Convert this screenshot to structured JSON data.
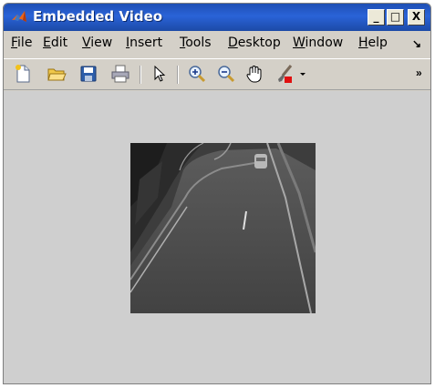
{
  "window": {
    "title": "Embedded Video"
  },
  "window_controls": {
    "minimize": "_",
    "maximize": "□",
    "close": "X"
  },
  "menu": {
    "items": [
      {
        "label": "File",
        "mnemonic": "F",
        "rest": "ile"
      },
      {
        "label": "Edit",
        "mnemonic": "E",
        "rest": "dit"
      },
      {
        "label": "View",
        "mnemonic": "V",
        "rest": "iew"
      },
      {
        "label": "Insert",
        "mnemonic": "I",
        "rest": "nsert"
      },
      {
        "label": "Tools",
        "mnemonic": "T",
        "rest": "ools"
      },
      {
        "label": "Desktop",
        "mnemonic": "D",
        "rest": "esktop"
      },
      {
        "label": "Window",
        "mnemonic": "W",
        "rest": "indow"
      },
      {
        "label": "Help",
        "mnemonic": "H",
        "rest": "elp"
      }
    ],
    "overflow": "↘"
  },
  "toolbar": {
    "icons": [
      "new-file-icon",
      "open-folder-icon",
      "save-icon",
      "print-icon",
      "pointer-arrow-icon",
      "zoom-in-icon",
      "zoom-out-icon",
      "pan-hand-icon",
      "brush-icon",
      "dropdown-arrow-icon"
    ],
    "overflow": "»"
  },
  "video": {
    "icon": "video-frame-road-scene"
  },
  "colors": {
    "titlebar": "#2a63d8",
    "chrome": "#d4d0c8",
    "canvas": "#cfcfcf"
  }
}
